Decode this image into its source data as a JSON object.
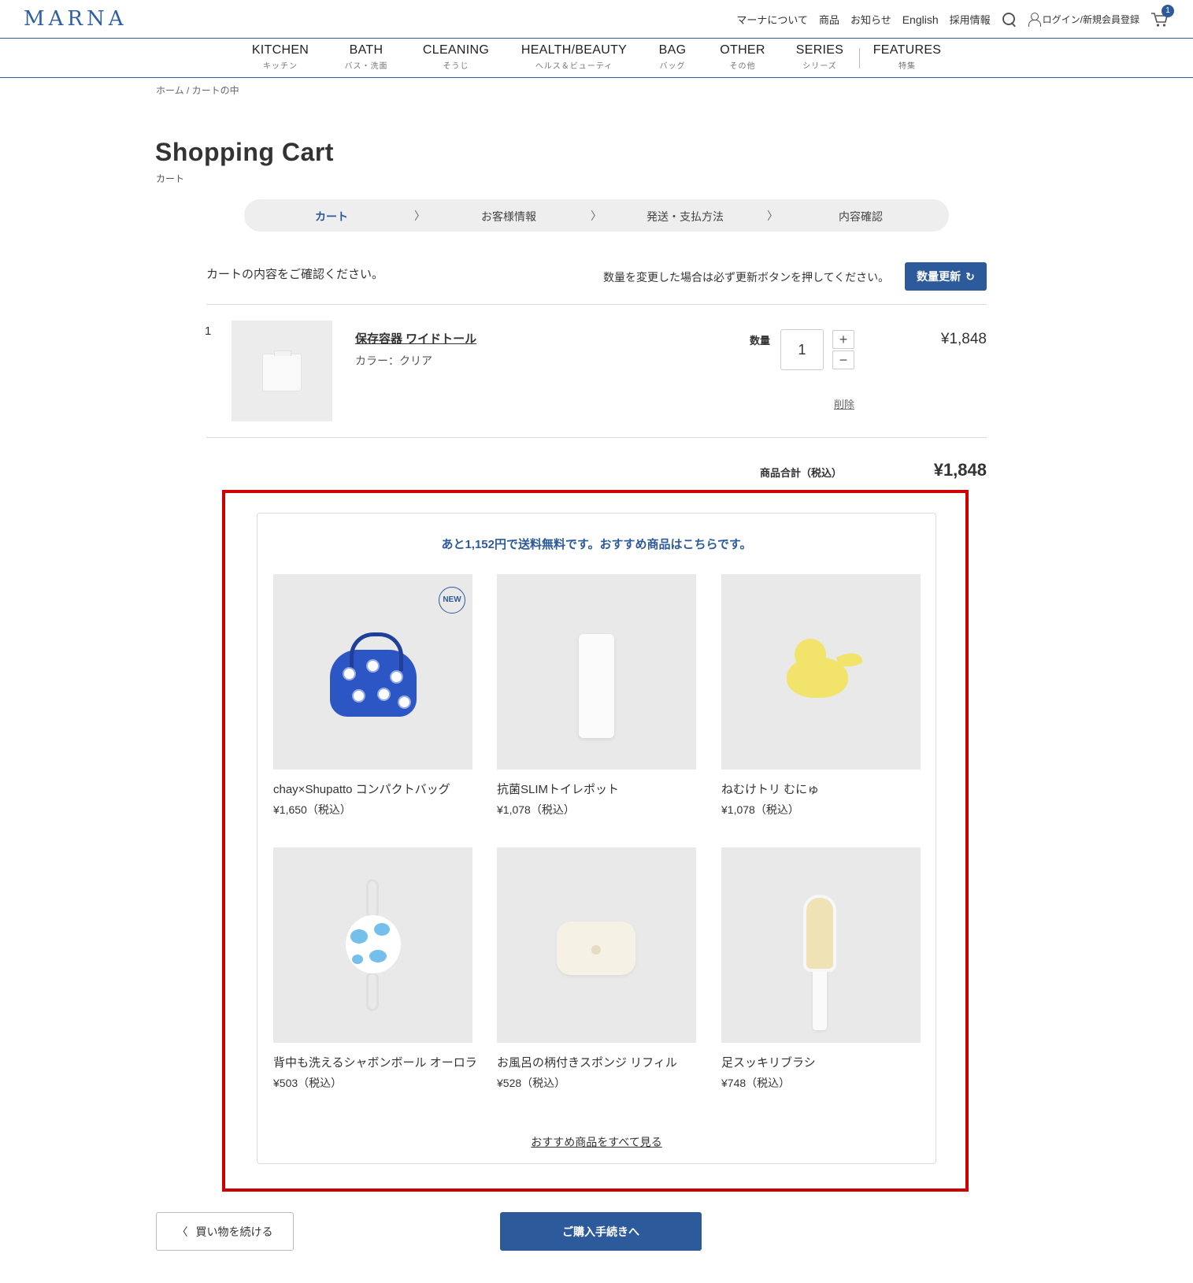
{
  "header": {
    "logo": "MARNA",
    "links": [
      "マーナについて",
      "商品",
      "お知らせ",
      "English",
      "採用情報"
    ],
    "login_label": "ログイン/新規会員登録",
    "cart_count": "1"
  },
  "nav": [
    {
      "en": "KITCHEN",
      "ja": "キッチン"
    },
    {
      "en": "BATH",
      "ja": "バス・洗面"
    },
    {
      "en": "CLEANING",
      "ja": "そうじ"
    },
    {
      "en": "HEALTH/BEAUTY",
      "ja": "ヘルス＆ビューティ"
    },
    {
      "en": "BAG",
      "ja": "バッグ"
    },
    {
      "en": "OTHER",
      "ja": "その他"
    },
    {
      "en": "SERIES",
      "ja": "シリーズ"
    },
    {
      "en": "FEATURES",
      "ja": "特集"
    }
  ],
  "breadcrumb": "ホーム / カートの中",
  "page": {
    "title": "Shopping Cart",
    "subtitle": "カート"
  },
  "steps": [
    "カート",
    "お客様情報",
    "発送・支払方法",
    "内容確認"
  ],
  "step_sep": "〉",
  "cart": {
    "message": "カートの内容をご確認ください。",
    "update_note": "数量を変更した場合は必ず更新ボタンを押してください。",
    "update_button": "数量更新",
    "update_icon": "↻",
    "items": [
      {
        "index": "1",
        "name": "保存容器 ワイドトール",
        "color": "カラー：クリア",
        "qty_label": "数量",
        "qty": "1",
        "plus": "+",
        "minus": "−",
        "price": "¥1,848",
        "delete": "削除"
      }
    ],
    "subtotal_label": "商品合計（税込）",
    "subtotal": "¥1,848"
  },
  "recommend": {
    "heading": "あと1,152円で送料無料です。おすすめ商品はこちらです。",
    "products": [
      {
        "name": "chay×Shupatto コンパクトバッグ",
        "price": "¥1,650（税込）",
        "badge": "NEW"
      },
      {
        "name": "抗菌SLIMトイレポット",
        "price": "¥1,078（税込）"
      },
      {
        "name": "ねむけトリ むにゅ",
        "price": "¥1,078（税込）"
      },
      {
        "name": "背中も洗えるシャボンボール オーロラ",
        "price": "¥503（税込）"
      },
      {
        "name": "お風呂の柄付きスポンジ リフィル",
        "price": "¥528（税込）"
      },
      {
        "name": "足スッキリブラシ",
        "price": "¥748（税込）"
      }
    ],
    "see_all": "おすすめ商品をすべて見る"
  },
  "footer_buttons": {
    "continue_icon": "〈",
    "continue": "買い物を続ける",
    "checkout": "ご購入手続きへ"
  }
}
